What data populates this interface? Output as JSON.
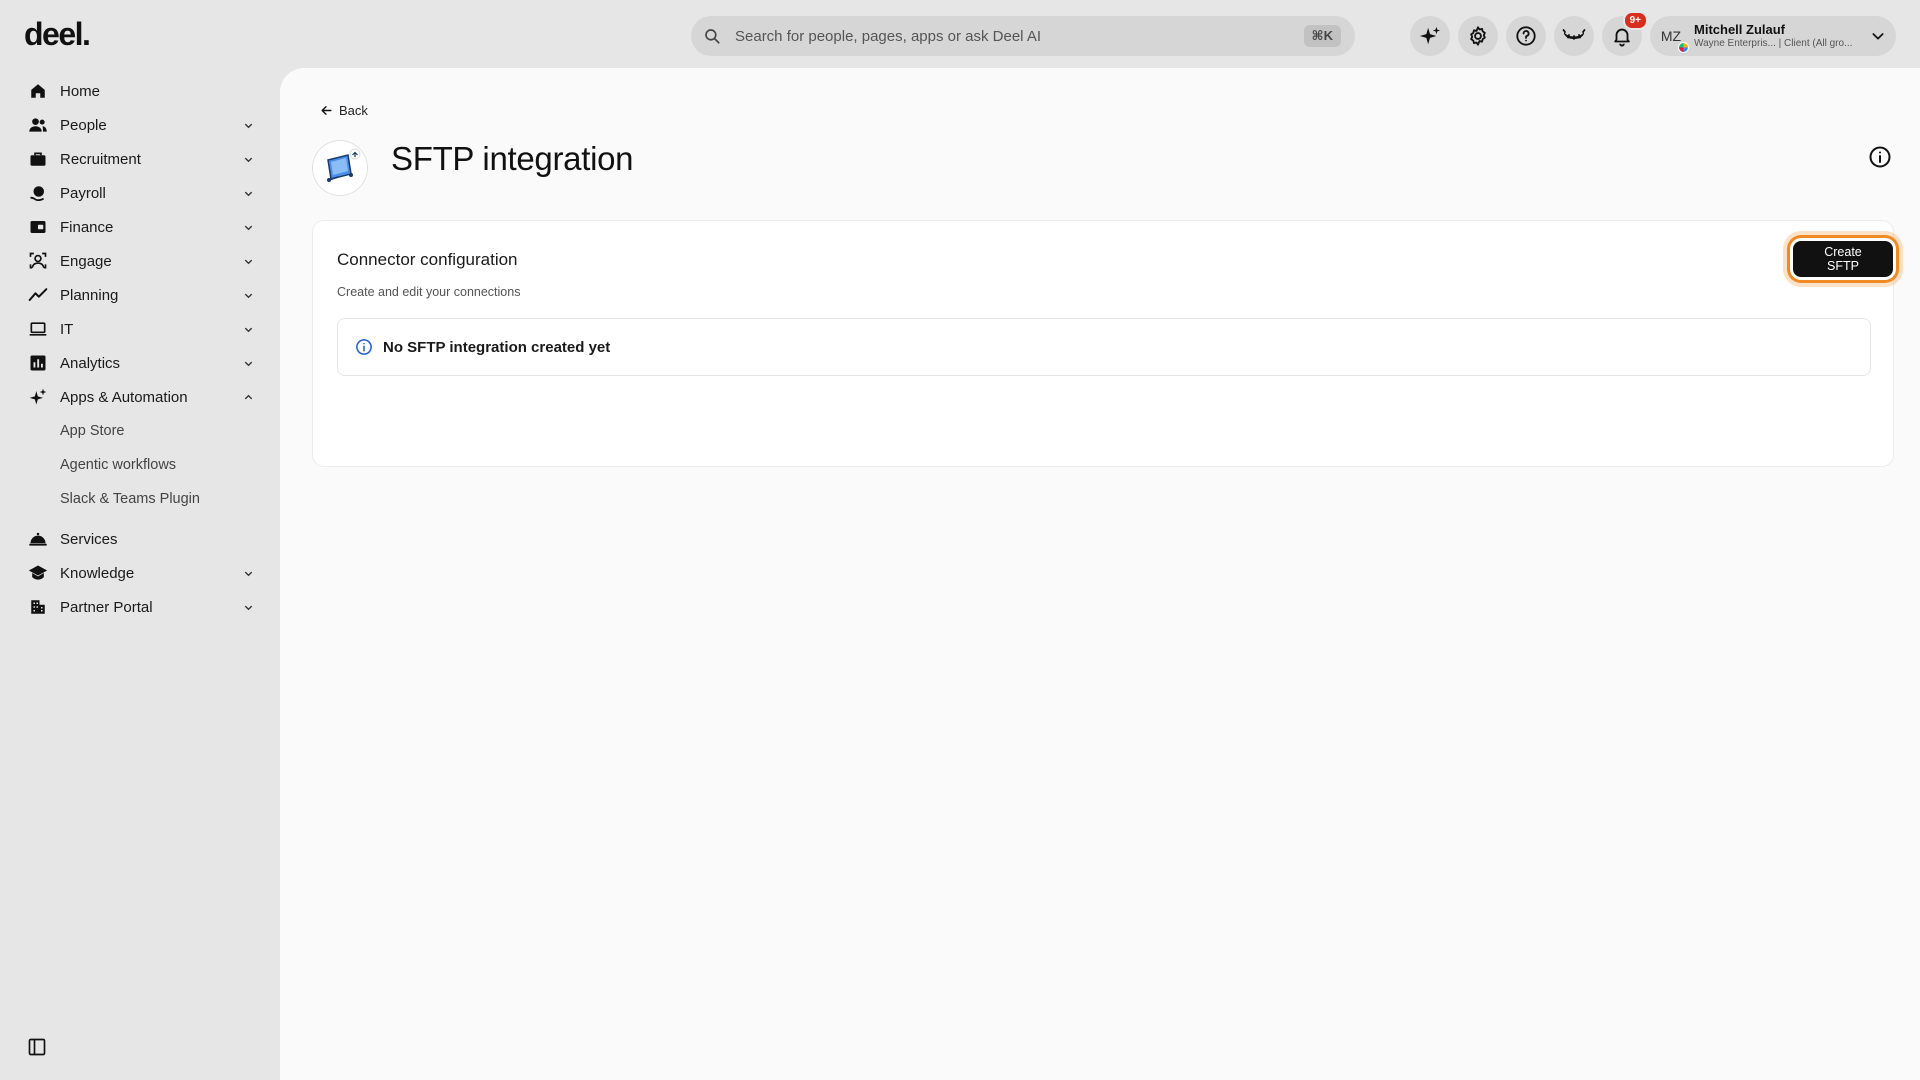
{
  "brand": {
    "logo_text": "deel."
  },
  "search": {
    "placeholder": "Search for people, pages, apps or ask Deel AI",
    "shortcut": "⌘K"
  },
  "topbar": {
    "icons": [
      "sparkle-icon",
      "gear-icon",
      "help-icon",
      "eye-mask-icon",
      "bell-icon"
    ],
    "notification_badge": "9+"
  },
  "user": {
    "initials": "MZ",
    "name": "Mitchell Zulauf",
    "subtitle": "Wayne Enterpris... | Client (All gro..."
  },
  "sidebar": {
    "items": [
      {
        "label": "Home",
        "icon": "home-icon"
      },
      {
        "label": "People",
        "icon": "people-icon"
      },
      {
        "label": "Recruitment",
        "icon": "briefcase-icon"
      },
      {
        "label": "Payroll",
        "icon": "payroll-icon"
      },
      {
        "label": "Finance",
        "icon": "wallet-icon"
      },
      {
        "label": "Engage",
        "icon": "engage-icon"
      },
      {
        "label": "Planning",
        "icon": "trend-icon"
      },
      {
        "label": "IT",
        "icon": "laptop-icon"
      },
      {
        "label": "Analytics",
        "icon": "bar-chart-icon"
      },
      {
        "label": "Apps & Automation",
        "icon": "sparkle-icon"
      },
      {
        "label": "Services",
        "icon": "cloche-icon"
      },
      {
        "label": "Knowledge",
        "icon": "graduation-cap-icon"
      },
      {
        "label": "Partner Portal",
        "icon": "building-icon"
      }
    ],
    "subitems": [
      "App Store",
      "Agentic workflows",
      "Slack & Teams Plugin"
    ]
  },
  "page": {
    "back_label": "Back",
    "title": "SFTP integration"
  },
  "card": {
    "title": "Connector configuration",
    "subtitle": "Create and edit your connections",
    "create_button": "Create SFTP",
    "empty_message": "No SFTP integration created yet"
  },
  "colors": {
    "accent_focus": "#f08a24",
    "button_dark": "#111111",
    "badge_red": "#d92d20"
  }
}
